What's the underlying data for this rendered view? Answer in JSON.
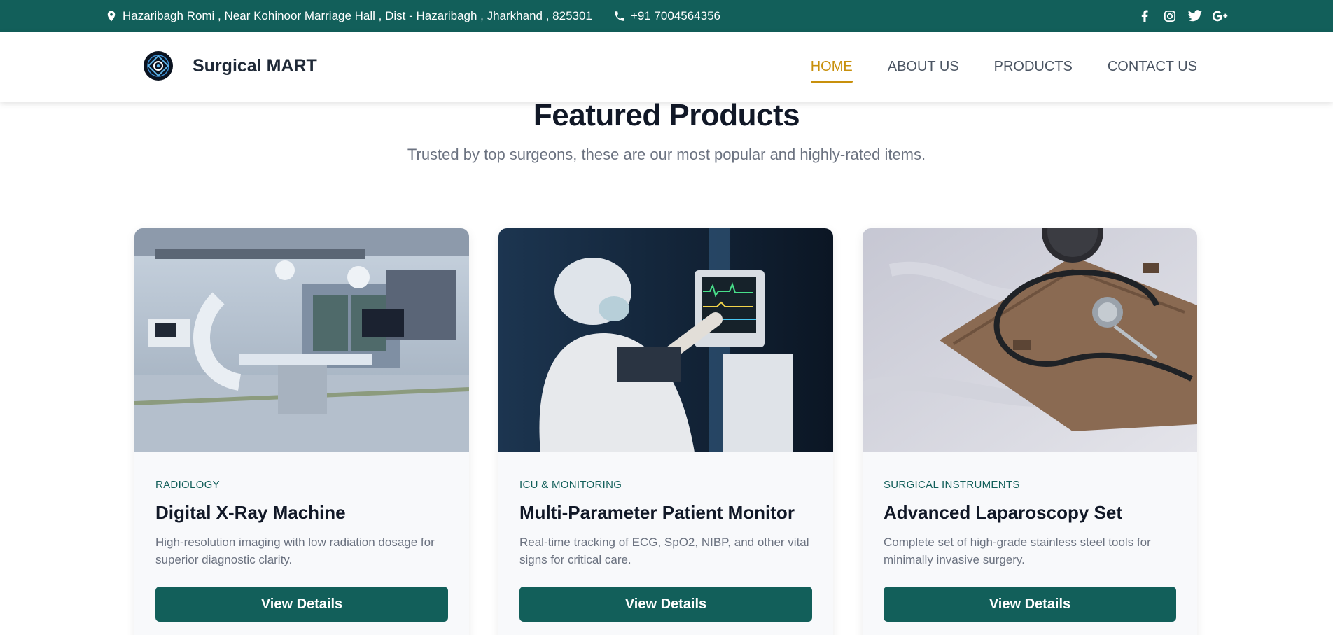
{
  "topbar": {
    "address": "Hazaribagh Romi , Near Kohinoor Marriage Hall , Dist - Hazaribagh , Jharkhand , 825301",
    "phone": "+91 7004564356",
    "address_icon": "map-pin-icon",
    "phone_icon": "phone-icon",
    "social": [
      "facebook-icon",
      "instagram-icon",
      "twitter-icon",
      "google-plus-icon"
    ],
    "background": "#125f5a"
  },
  "header": {
    "brand_name": "Surgical MART",
    "nav": [
      {
        "label": "HOME",
        "active": true
      },
      {
        "label": "ABOUT US",
        "active": false
      },
      {
        "label": "PRODUCTS",
        "active": false
      },
      {
        "label": "CONTACT US",
        "active": false
      }
    ],
    "accent": "#c8900c"
  },
  "featured": {
    "title": "Featured Products",
    "subtitle": "Trusted by top surgeons, these are our most popular and highly-rated items."
  },
  "products": [
    {
      "category": "RADIOLOGY",
      "name": "Digital X-Ray Machine",
      "description": "High-resolution imaging with low radiation dosage for superior diagnostic clarity.",
      "button": "View Details"
    },
    {
      "category": "ICU & MONITORING",
      "name": "Multi-Parameter Patient Monitor",
      "description": "Real-time tracking of ECG, SpO2, NIBP, and other vital signs for critical care.",
      "button": "View Details"
    },
    {
      "category": "SURGICAL INSTRUMENTS",
      "name": "Advanced Laparoscopy Set",
      "description": "Complete set of high-grade stainless steel tools for minimally invasive surgery.",
      "button": "View Details"
    }
  ],
  "colors": {
    "primary": "#125f5a",
    "accent": "#c8900c",
    "text_dark": "#111827",
    "text_muted": "#6b7280"
  }
}
